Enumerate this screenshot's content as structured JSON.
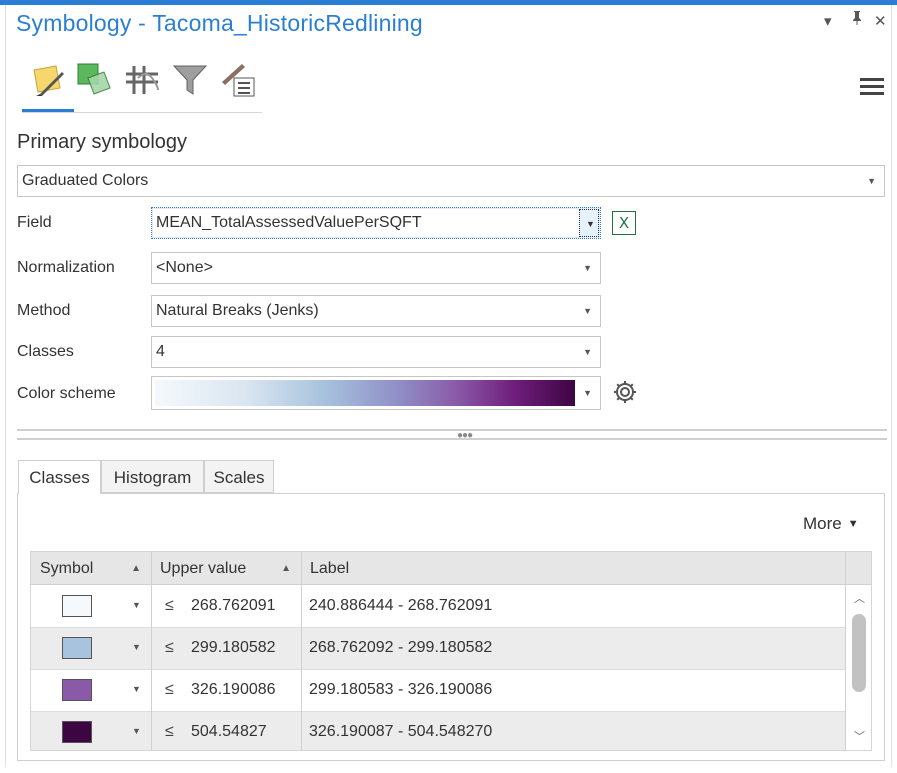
{
  "window": {
    "title": "Symbology - Tacoma_HistoricRedlining",
    "controls": {
      "dropdown": "▾",
      "pin": "⊥",
      "close": "✕"
    }
  },
  "ribbon": {
    "icons": [
      "primary-symbology-icon",
      "vary-symbology-icon",
      "symbol-layer-drawing-icon",
      "filter-icon",
      "label-classes-icon"
    ],
    "active_index": 0
  },
  "primary_symbology": {
    "heading": "Primary symbology",
    "renderer": "Graduated Colors",
    "field_label": "Field",
    "field_value": "MEAN_TotalAssessedValuePerSQFT",
    "normalization_label": "Normalization",
    "normalization_value": "<None>",
    "method_label": "Method",
    "method_value": "Natural Breaks (Jenks)",
    "classes_label": "Classes",
    "classes_value": "4",
    "color_scheme_label": "Color scheme",
    "color_scheme_colors": [
      "#f5f9fc",
      "#a8c3de",
      "#8a59a8",
      "#3d0542"
    ]
  },
  "tabs": [
    {
      "label": "Classes",
      "active": true
    },
    {
      "label": "Histogram",
      "active": false
    },
    {
      "label": "Scales",
      "active": false
    }
  ],
  "classes_panel": {
    "more_label": "More",
    "columns": {
      "symbol": "Symbol",
      "upper": "Upper value",
      "label": "Label"
    },
    "rows": [
      {
        "color": "#f5f9fc",
        "op": "≤",
        "upper": "268.762091",
        "label": "240.886444 - 268.762091"
      },
      {
        "color": "#a8c3de",
        "op": "≤",
        "upper": "299.180582",
        "label": "268.762092 - 299.180582"
      },
      {
        "color": "#8a59a8",
        "op": "≤",
        "upper": "326.190086",
        "label": "299.180583 - 326.190086"
      },
      {
        "color": "#3d0542",
        "op": "≤",
        "upper": "504.54827",
        "label": "326.190087 - 504.548270"
      }
    ]
  }
}
